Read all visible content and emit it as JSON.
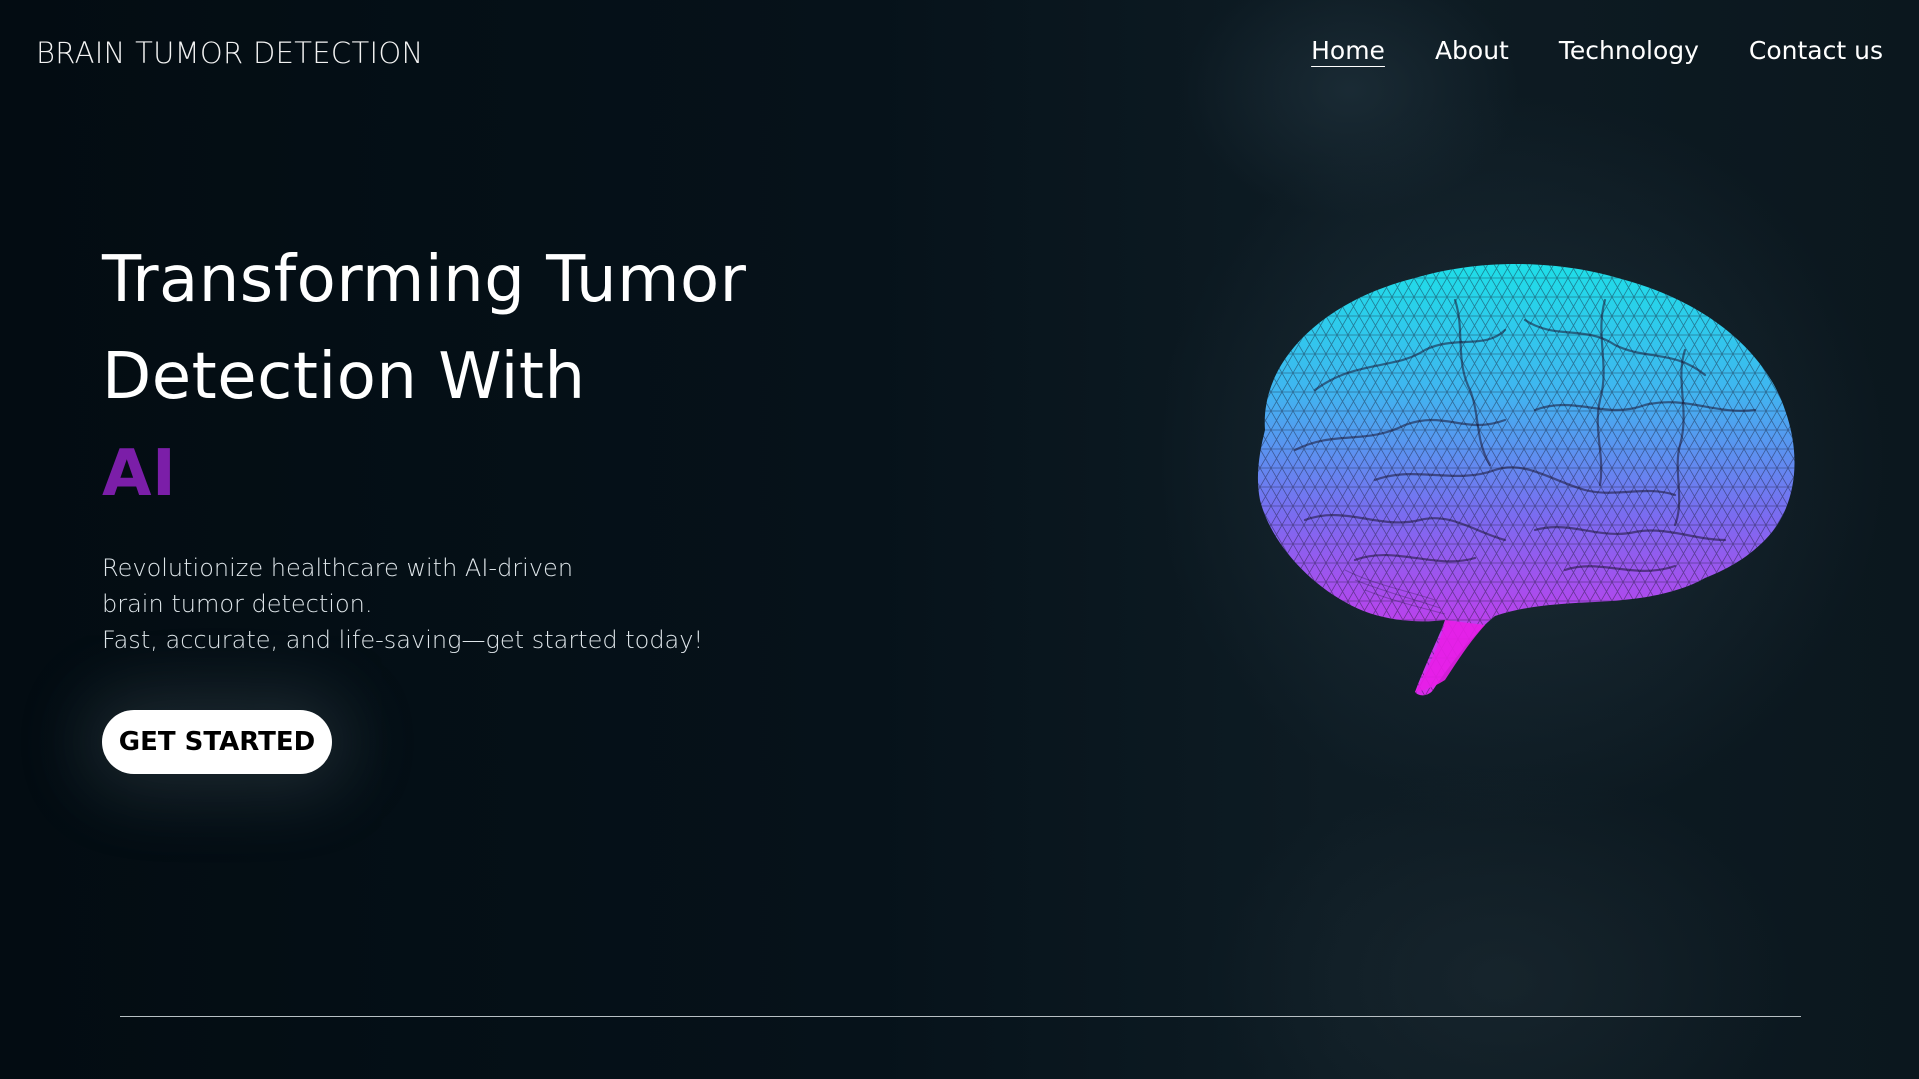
{
  "header": {
    "brand": "BRAIN TUMOR DETECTION",
    "nav": [
      {
        "label": "Home",
        "active": true
      },
      {
        "label": "About",
        "active": false
      },
      {
        "label": "Technology",
        "active": false
      },
      {
        "label": "Contact us",
        "active": false
      }
    ]
  },
  "hero": {
    "title_line1": "Transforming Tumor",
    "title_line2": "Detection With",
    "title_accent": "AI",
    "desc_line1": "Revolutionize healthcare with AI-driven",
    "desc_line2": "brain tumor detection.",
    "desc_line3": "Fast, accurate, and life-saving—get started today!",
    "cta_label": "GET STARTED"
  },
  "colors": {
    "accent": "#7b1ea8",
    "brain_top": "#18e6e6",
    "brain_mid": "#7a6cf0",
    "brain_bottom": "#e81ee8"
  },
  "icons": {
    "hero_image": "wireframe-brain"
  }
}
